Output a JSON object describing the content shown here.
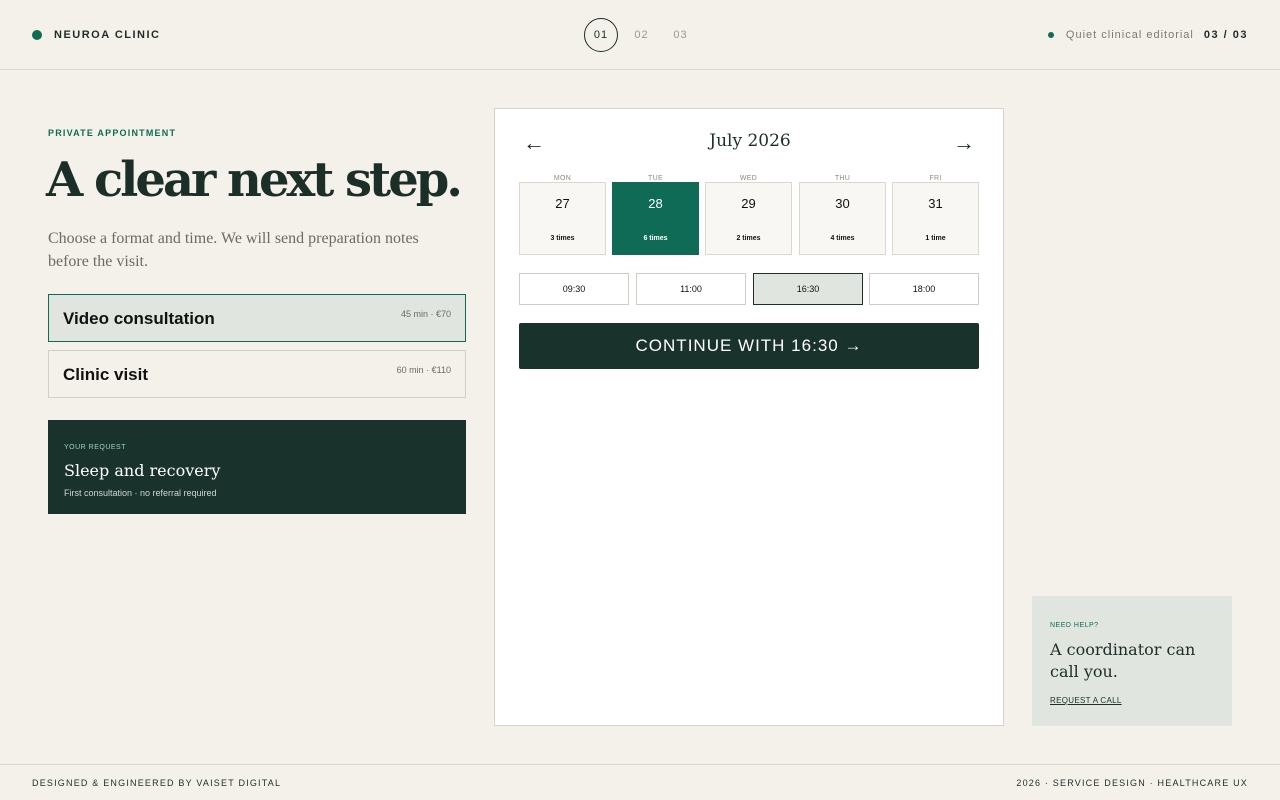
{
  "header": {
    "brand": "NEUROA CLINIC",
    "steps": [
      "01",
      "02",
      "03"
    ],
    "tagline": "Quiet clinical editorial",
    "step_count": "03 / 03"
  },
  "left": {
    "eyebrow": "PRIVATE APPOINTMENT",
    "headline": "A clear next step.",
    "intro": "Choose a format and time. We will send preparation notes before the visit.",
    "formats": [
      {
        "title": "Video consultation",
        "meta": "45 min · €70",
        "selected": true
      },
      {
        "title": "Clinic visit",
        "meta": "60 min · €110",
        "selected": false
      }
    ],
    "request": {
      "label": "YOUR REQUEST",
      "title": "Sleep and recovery",
      "subtitle": "First consultation · no referral required"
    }
  },
  "calendar": {
    "prev_icon": "←",
    "next_icon": "→",
    "month": "July 2026",
    "days": [
      {
        "name": "MON",
        "date": "27",
        "count": "3 times",
        "selected": false
      },
      {
        "name": "TUE",
        "date": "28",
        "count": "6 times",
        "selected": true
      },
      {
        "name": "WED",
        "date": "29",
        "count": "2 times",
        "selected": false
      },
      {
        "name": "THU",
        "date": "30",
        "count": "4 times",
        "selected": false
      },
      {
        "name": "FRI",
        "date": "31",
        "count": "1 time",
        "selected": false
      }
    ],
    "times": [
      {
        "label": "09:30",
        "selected": false
      },
      {
        "label": "11:00",
        "selected": false
      },
      {
        "label": "16:30",
        "selected": true
      },
      {
        "label": "18:00",
        "selected": false
      }
    ],
    "continue_label": "CONTINUE WITH 16:30 →"
  },
  "help": {
    "label": "NEED HELP?",
    "title": "A coordinator can call you.",
    "link": "REQUEST A CALL"
  },
  "footer": {
    "left": "DESIGNED & ENGINEERED BY VAISET DIGITAL",
    "right": "2026 · SERVICE DESIGN · HEALTHCARE UX"
  },
  "colors": {
    "accent": "#0f6b55",
    "dark": "#19322b",
    "background": "#f4f1ea",
    "selected_tint": "#e0e6df"
  }
}
